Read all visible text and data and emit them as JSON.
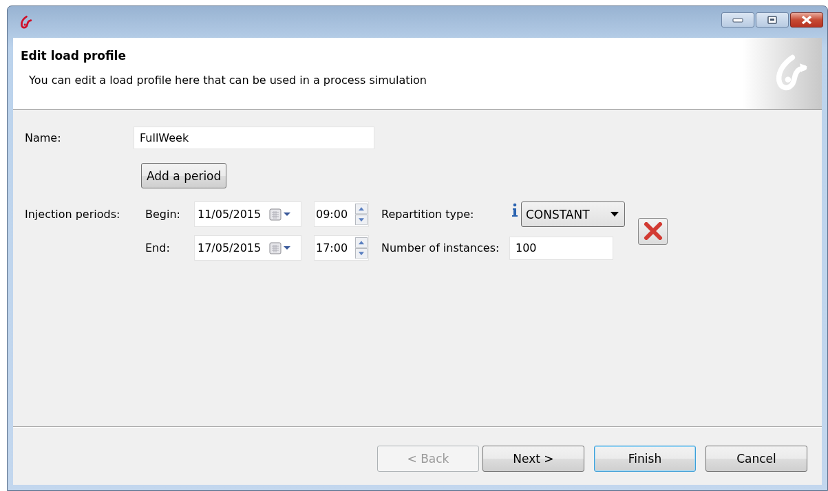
{
  "header": {
    "title": "Edit load profile",
    "description": "You can edit a load profile here that can be used in a process simulation"
  },
  "form": {
    "name_label": "Name:",
    "name_value": "FullWeek",
    "add_button": "Add a period",
    "periods_label": "Injection periods:",
    "periods": [
      {
        "begin_label": "Begin:",
        "begin_date": "11/05/2015",
        "begin_time": "09:00",
        "end_label": "End:",
        "end_date": "17/05/2015",
        "end_time": "17:00",
        "repartition_label": "Repartition type:",
        "repartition": "CONSTANT",
        "instances_label": "Number of instances:",
        "instances": "100"
      }
    ]
  },
  "buttons": [
    {
      "label": "< Back",
      "disabled": true,
      "default": false
    },
    {
      "label": "Next >",
      "disabled": false,
      "default": false
    },
    {
      "label": "Finish",
      "disabled": false,
      "default": true
    },
    {
      "label": "Cancel",
      "disabled": false,
      "default": false
    }
  ]
}
